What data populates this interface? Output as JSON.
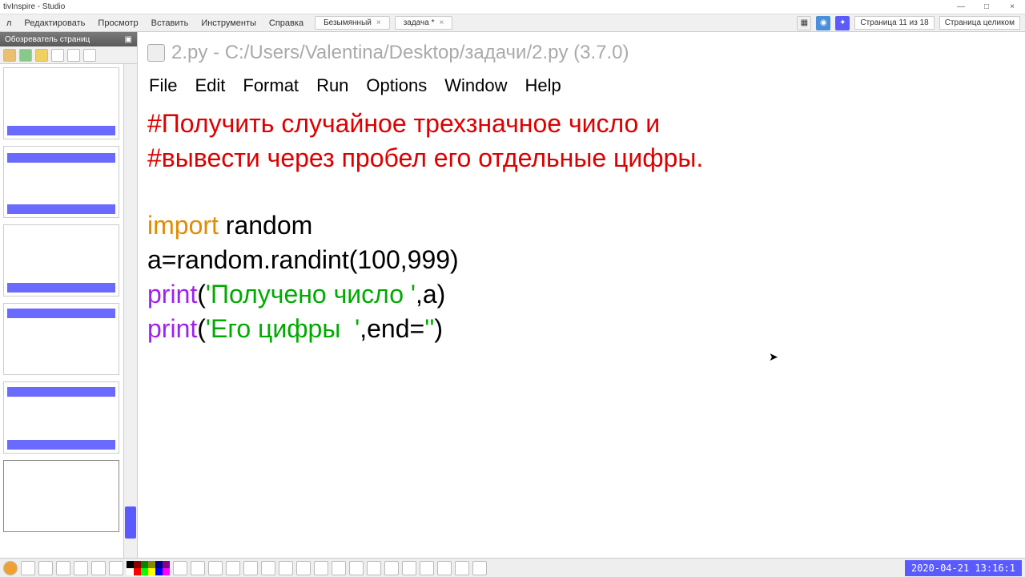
{
  "window": {
    "title": "tivInspire - Studio"
  },
  "menu": {
    "items": [
      "л",
      "Редактировать",
      "Просмотр",
      "Вставить",
      "Инструменты",
      "Справка"
    ],
    "tabs": [
      {
        "name": "Безымянный",
        "close": "×"
      },
      {
        "name": "задача *",
        "close": "×"
      }
    ],
    "page_indicator": "Страница 11 из 18",
    "view_mode": "Страница целиком"
  },
  "sidebar": {
    "title": "Обозреватель страниц"
  },
  "editor": {
    "title": "2.py - C:/Users/Valentina/Desktop/задачи/2.py (3.7.0)",
    "menu": [
      "File",
      "Edit",
      "Format",
      "Run",
      "Options",
      "Window",
      "Help"
    ],
    "code": {
      "l1": "#Получить случайное трехзначное число и",
      "l2": "#вывести через пробел его отдельные цифры.",
      "l3_kw": "import",
      "l3_rest": " random",
      "l4": "a=random.randint(100,999)",
      "l5_fn": "print",
      "l5_p1": "(",
      "l5_str": "'Получено число '",
      "l5_p2": ",a)",
      "l6_fn": "print",
      "l6_p1": "(",
      "l6_str1": "'Его цифры  '",
      "l6_p2": ",end=",
      "l6_str2": "''",
      "l6_p3": ")"
    }
  },
  "clock": "2020-04-21 13:16:1",
  "palette_colors": [
    "#000",
    "#800",
    "#080",
    "#880",
    "#008",
    "#808",
    "#fff",
    "#f00",
    "#0f0",
    "#ff0",
    "#00f",
    "#f0f"
  ]
}
